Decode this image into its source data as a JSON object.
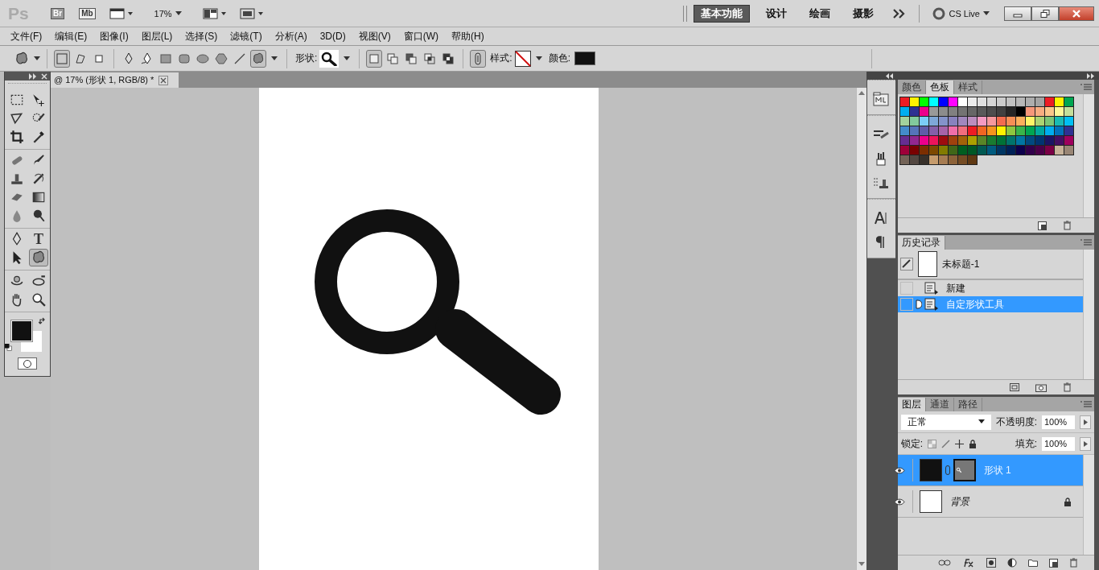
{
  "app": {
    "logo": "Ps",
    "bridge": "Br",
    "mini_bridge": "Mb",
    "zoom": "17%",
    "cs_live": "CS Live"
  },
  "workspaces": [
    {
      "label": "基本功能",
      "selected": true
    },
    {
      "label": "设计",
      "selected": false
    },
    {
      "label": "绘画",
      "selected": false
    },
    {
      "label": "摄影",
      "selected": false
    }
  ],
  "menu": [
    "文件(F)",
    "编辑(E)",
    "图像(I)",
    "图层(L)",
    "选择(S)",
    "滤镜(T)",
    "分析(A)",
    "3D(D)",
    "视图(V)",
    "窗口(W)",
    "帮助(H)"
  ],
  "options": {
    "path_modes": [
      {
        "kind": "shape-layer",
        "selected": true
      },
      {
        "kind": "paths",
        "selected": false
      },
      {
        "kind": "fill-pixels",
        "selected": false
      }
    ],
    "shapes": [
      {
        "kind": "pen",
        "selected": false
      },
      {
        "kind": "freeform-pen",
        "selected": false
      },
      {
        "kind": "rectangle",
        "selected": false
      },
      {
        "kind": "rounded-rectangle",
        "selected": false
      },
      {
        "kind": "ellipse",
        "selected": false
      },
      {
        "kind": "polygon",
        "selected": false
      },
      {
        "kind": "line",
        "selected": false
      },
      {
        "kind": "custom",
        "selected": true
      }
    ],
    "shape_label": "形状:",
    "combine_modes": [
      {
        "kind": "new",
        "selected": true
      },
      {
        "kind": "add",
        "selected": false
      },
      {
        "kind": "subtract",
        "selected": false
      },
      {
        "kind": "intersect",
        "selected": false
      },
      {
        "kind": "exclude",
        "selected": false
      }
    ],
    "style_label": "样式:",
    "color_label": "颜色:"
  },
  "document": {
    "tab": "@ 17% (形状 1, RGB/8) *"
  },
  "tool_groups": [
    [
      {
        "kind": "marquee",
        "selected": false
      },
      {
        "kind": "move",
        "selected": false
      },
      {
        "kind": "lasso",
        "selected": false
      },
      {
        "kind": "quick-select",
        "selected": false
      },
      {
        "kind": "crop",
        "selected": false
      },
      {
        "kind": "eyedropper",
        "selected": false
      }
    ],
    [
      {
        "kind": "healing",
        "selected": false
      },
      {
        "kind": "brush",
        "selected": false
      },
      {
        "kind": "stamp",
        "selected": false
      },
      {
        "kind": "history-brush",
        "selected": false
      },
      {
        "kind": "eraser",
        "selected": false
      },
      {
        "kind": "gradient",
        "selected": false
      },
      {
        "kind": "blur",
        "selected": false
      },
      {
        "kind": "dodge",
        "selected": false
      }
    ],
    [
      {
        "kind": "pen",
        "selected": false
      },
      {
        "kind": "type",
        "label": "T",
        "selected": false
      },
      {
        "kind": "path-select",
        "selected": false
      },
      {
        "kind": "custom-shape",
        "selected": true
      }
    ],
    [
      {
        "kind": "rotate-3d",
        "selected": false
      },
      {
        "kind": "orbit-3d",
        "selected": false
      },
      {
        "kind": "hand",
        "selected": false
      },
      {
        "kind": "zoom",
        "selected": false
      }
    ]
  ],
  "swatches_panel": {
    "tabs": [
      {
        "label": "颜色",
        "selected": false
      },
      {
        "label": "色板",
        "selected": true
      },
      {
        "label": "样式",
        "selected": false
      }
    ],
    "swatches": [
      {
        "color": "#ed1c24"
      },
      {
        "color": "#fff200"
      },
      {
        "color": "#00ff00"
      },
      {
        "color": "#00ffff"
      },
      {
        "color": "#0000ff"
      },
      {
        "color": "#ff00ff"
      },
      {
        "color": "#ffffff"
      },
      {
        "color": "#ebebeb"
      },
      {
        "color": "#e0e0e0"
      },
      {
        "color": "#d6d6d6"
      },
      {
        "color": "#cccccc"
      },
      {
        "color": "#c2c2c2"
      },
      {
        "color": "#b8b8b8"
      },
      {
        "color": "#adadad"
      },
      {
        "color": "#a3a3a3"
      },
      {
        "color": "#ed1c24"
      },
      {
        "color": "#fff200"
      },
      {
        "color": "#00a651"
      },
      {
        "color": "#00aeef"
      },
      {
        "color": "#2e3192"
      },
      {
        "color": "#ec008c"
      },
      {
        "color": "#999999"
      },
      {
        "color": "#8c8c8c"
      },
      {
        "color": "#808080"
      },
      {
        "color": "#737373"
      },
      {
        "color": "#666666"
      },
      {
        "color": "#595959"
      },
      {
        "color": "#4d4d4d"
      },
      {
        "color": "#404040"
      },
      {
        "color": "#262626"
      },
      {
        "color": "#000000"
      },
      {
        "color": "#f7977a"
      },
      {
        "color": "#f9ad81"
      },
      {
        "color": "#fdc68a"
      },
      {
        "color": "#fff79a"
      },
      {
        "color": "#c4df9b"
      },
      {
        "color": "#a3d39c"
      },
      {
        "color": "#82ca9d"
      },
      {
        "color": "#7bcdf6"
      },
      {
        "color": "#7ea7d8"
      },
      {
        "color": "#8493ca"
      },
      {
        "color": "#8882be"
      },
      {
        "color": "#a187be"
      },
      {
        "color": "#bc8dbf"
      },
      {
        "color": "#f49ac2"
      },
      {
        "color": "#f6989d"
      },
      {
        "color": "#f26c4f"
      },
      {
        "color": "#f68e55"
      },
      {
        "color": "#fbaf5c"
      },
      {
        "color": "#fff467"
      },
      {
        "color": "#acd372"
      },
      {
        "color": "#7cc576"
      },
      {
        "color": "#1abbb4"
      },
      {
        "color": "#00bff3"
      },
      {
        "color": "#438ccb"
      },
      {
        "color": "#5574b9"
      },
      {
        "color": "#605ca8"
      },
      {
        "color": "#855fa8"
      },
      {
        "color": "#a763a8"
      },
      {
        "color": "#f06ea9"
      },
      {
        "color": "#f26d7d"
      },
      {
        "color": "#ed1c24"
      },
      {
        "color": "#f26522"
      },
      {
        "color": "#f7941d"
      },
      {
        "color": "#fff200"
      },
      {
        "color": "#8dc73f"
      },
      {
        "color": "#39b54a"
      },
      {
        "color": "#00a651"
      },
      {
        "color": "#00a99d"
      },
      {
        "color": "#00aeef"
      },
      {
        "color": "#0072bc"
      },
      {
        "color": "#2e3192"
      },
      {
        "color": "#662d91"
      },
      {
        "color": "#92278f"
      },
      {
        "color": "#ec008c"
      },
      {
        "color": "#ed145b"
      },
      {
        "color": "#9e0b0f"
      },
      {
        "color": "#a0410d"
      },
      {
        "color": "#a36209"
      },
      {
        "color": "#aba000"
      },
      {
        "color": "#598527"
      },
      {
        "color": "#197b30"
      },
      {
        "color": "#007236"
      },
      {
        "color": "#00746b"
      },
      {
        "color": "#0076a3"
      },
      {
        "color": "#004a80"
      },
      {
        "color": "#003471"
      },
      {
        "color": "#1b1464"
      },
      {
        "color": "#440e62"
      },
      {
        "color": "#9e005d"
      },
      {
        "color": "#9e0039"
      },
      {
        "color": "#790000"
      },
      {
        "color": "#7b2e00"
      },
      {
        "color": "#7d4900"
      },
      {
        "color": "#827b00"
      },
      {
        "color": "#406618"
      },
      {
        "color": "#005e20"
      },
      {
        "color": "#005826"
      },
      {
        "color": "#005952"
      },
      {
        "color": "#005b7f"
      },
      {
        "color": "#003663"
      },
      {
        "color": "#002157"
      },
      {
        "color": "#0d004c"
      },
      {
        "color": "#32004b"
      },
      {
        "color": "#4b0049"
      },
      {
        "color": "#7b0046"
      },
      {
        "color": "#c7b299"
      },
      {
        "color": "#998675"
      },
      {
        "color": "#736357"
      },
      {
        "color": "#534741"
      },
      {
        "color": "#37302a"
      },
      {
        "color": "#c69c6d"
      },
      {
        "color": "#a67c52"
      },
      {
        "color": "#8c6239"
      },
      {
        "color": "#754c24"
      },
      {
        "color": "#603913"
      }
    ]
  },
  "history": {
    "title": "历史记录",
    "snapshot": "未标题-1",
    "steps": [
      {
        "label": "新建",
        "selected": false
      },
      {
        "label": "自定形状工具",
        "selected": true
      }
    ]
  },
  "layers_panel": {
    "tabs": [
      {
        "label": "图层",
        "selected": true
      },
      {
        "label": "通道",
        "selected": false
      },
      {
        "label": "路径",
        "selected": false
      }
    ],
    "blend_mode": "正常",
    "opacity_label": "不透明度:",
    "opacity": "100%",
    "lock_label": "锁定:",
    "fill_label": "填充:",
    "fill": "100%",
    "layers": [
      {
        "name": "形状 1",
        "kind": "shape",
        "selected": true,
        "visible": true,
        "locked": false
      },
      {
        "name": "背景",
        "kind": "background",
        "selected": false,
        "visible": true,
        "locked": true
      }
    ]
  }
}
